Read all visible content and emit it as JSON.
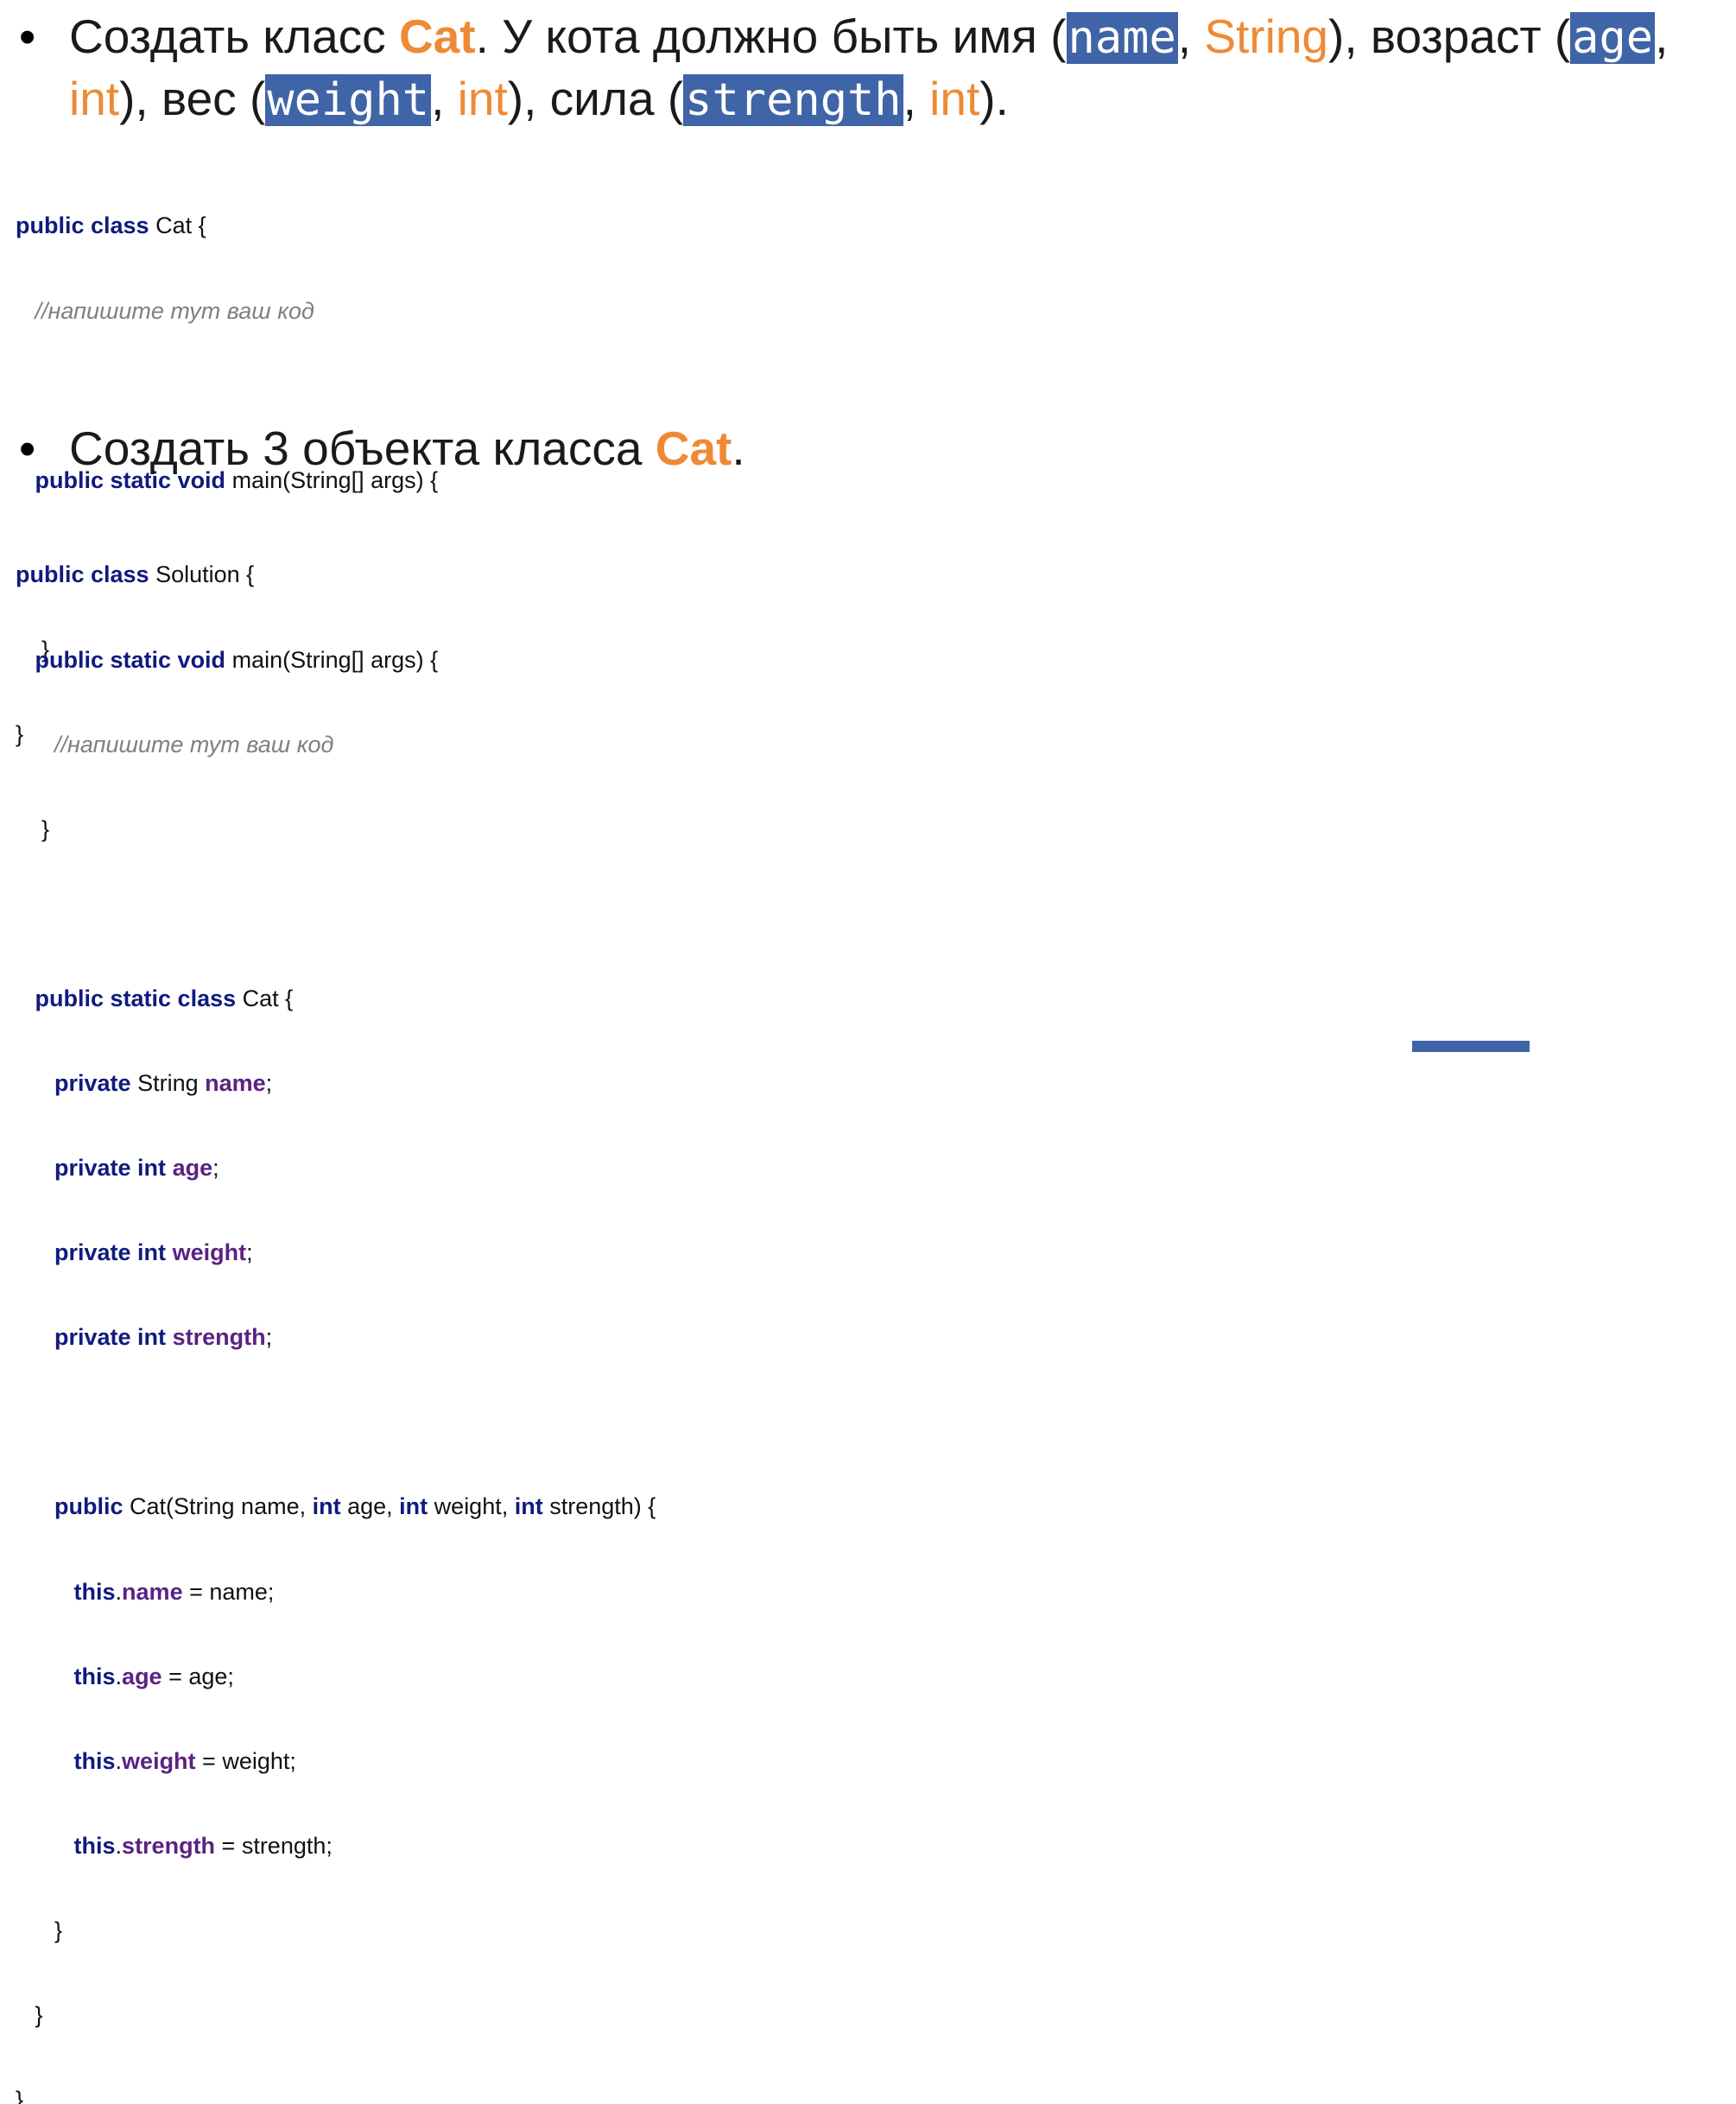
{
  "bullet1": {
    "t1": "Создать класс ",
    "cat": "Cat",
    "t2": ". У кота должно быть имя (",
    "name": "name",
    "comma1": ", ",
    "string": "String",
    "t3": "), возраст (",
    "age": "age",
    "comma2": ",",
    "int1": "int",
    "t4": "), вес (",
    "weight": "weight",
    "comma3": ", ",
    "int2": "int",
    "t5": "), сила (",
    "strength": "strength",
    "comma4": ", ",
    "int3": "int",
    "t6": ")."
  },
  "bullet2": {
    "t1": "Создать 3 объекта класса ",
    "cat": "Cat",
    "t2": "."
  },
  "code1": {
    "l1_kw": "public class",
    "l1_rest": " Cat {",
    "l2_comment": "//напишите тут ваш код",
    "l4_kw": "public static void",
    "l4_rest": " main(String[] args) {",
    "l6": "}",
    "l7": "}"
  },
  "code2": {
    "l1_kw": "public class",
    "l1_rest": " Solution {",
    "l2_kw": "public static void",
    "l2_rest": " main(String[] args) {",
    "l3_comment": "//напишите тут ваш код",
    "l4": "}",
    "l6_kw": "public static class",
    "l6_rest": " Cat {",
    "f1_kw": "private",
    "f1_type": " String ",
    "f1_name": "name",
    "f1_end": ";",
    "f2_kw": "private int",
    "f2_name": "age",
    "f2_end": ";",
    "f3_kw": "private int",
    "f3_name": "weight",
    "f3_end": ";",
    "f4_kw": "private int",
    "f4_name": "strength",
    "f4_end": ";",
    "ctor_kw": "public",
    "ctor_a": " Cat(String name, ",
    "ctor_int1": "int",
    "ctor_b": " age, ",
    "ctor_int2": "int",
    "ctor_c": " weight, ",
    "ctor_int3": "int",
    "ctor_d": " strength) {",
    "a1_this": "this",
    "a1_dot": ".",
    "a1_f": "name",
    "a1_rest": " = name;",
    "a2_this": "this",
    "a2_dot": ".",
    "a2_f": "age",
    "a2_rest": " = age;",
    "a3_this": "this",
    "a3_dot": ".",
    "a3_f": "weight",
    "a3_rest": " = weight;",
    "a4_this": "this",
    "a4_dot": ".",
    "a4_f": "strength",
    "a4_rest": " = strength;",
    "c1": "}",
    "c2": "}",
    "c3": "}"
  },
  "colors": {
    "keyword": "#0f1b7d",
    "field": "#5a2282",
    "accent": "#ee8a35",
    "highlight": "#3f64a7",
    "comment": "#7f7f7f"
  }
}
